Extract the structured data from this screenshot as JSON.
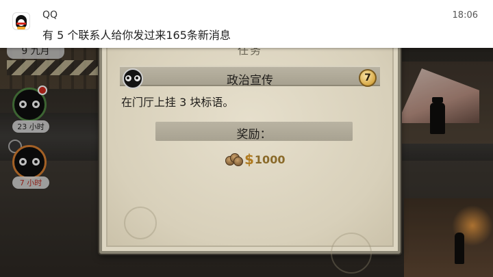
{
  "notification": {
    "app_name": "QQ",
    "message": "有 5 个联系人给你发过来165条新消息",
    "time": "18:06"
  },
  "hud": {
    "day_label": "9 九月",
    "timers": [
      "23 小时",
      "7 小时"
    ]
  },
  "dialog": {
    "title": "任务",
    "task_name": "政治宣传",
    "level": "7",
    "description": "在门厅上挂 3 块标语。",
    "reward_label": "奖励：",
    "reward_currency": "$",
    "reward_amount": "1000"
  },
  "icons": {
    "notification_app": "qq-penguin-icon",
    "task": "eyes-face-icon",
    "close": "close-x-icon",
    "reward": "coins-icon"
  },
  "colors": {
    "dialog_bg": "#ddd6c2",
    "badge_gold": "#d8a945",
    "money": "#b07a1e"
  }
}
